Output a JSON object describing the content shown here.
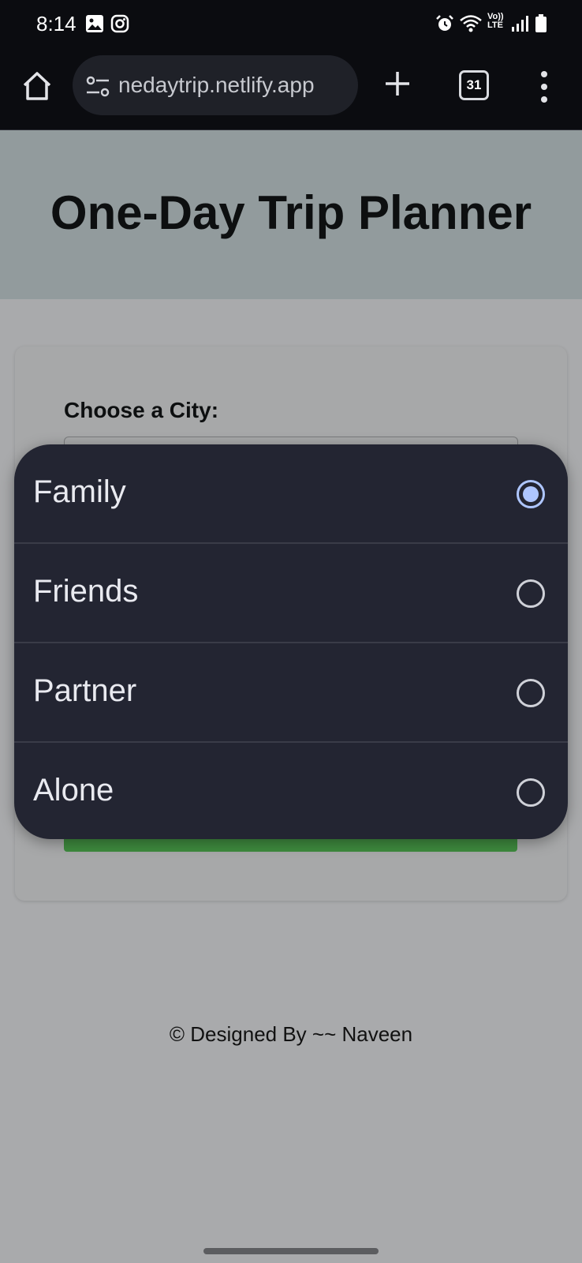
{
  "status_bar": {
    "time": "8:14",
    "left_icons": [
      "gallery-icon",
      "instagram-icon"
    ],
    "right_icons": [
      "alarm-icon",
      "wifi-icon",
      "volte-icon",
      "signal-icon",
      "battery-icon"
    ]
  },
  "browser": {
    "url": "nedaytrip.netlify.app",
    "tab_count": "31"
  },
  "page": {
    "title": "One-Day Trip Planner",
    "city_label": "Choose a City:",
    "footer": "© Designed By ~~ Naveen"
  },
  "dialog": {
    "options": [
      {
        "label": "Family",
        "selected": true
      },
      {
        "label": "Friends",
        "selected": false
      },
      {
        "label": "Partner",
        "selected": false
      },
      {
        "label": "Alone",
        "selected": false
      }
    ],
    "colors": {
      "selected_radio": "#aec6ff",
      "unselected_radio": "#cfd1d8",
      "background": "#232532"
    }
  }
}
